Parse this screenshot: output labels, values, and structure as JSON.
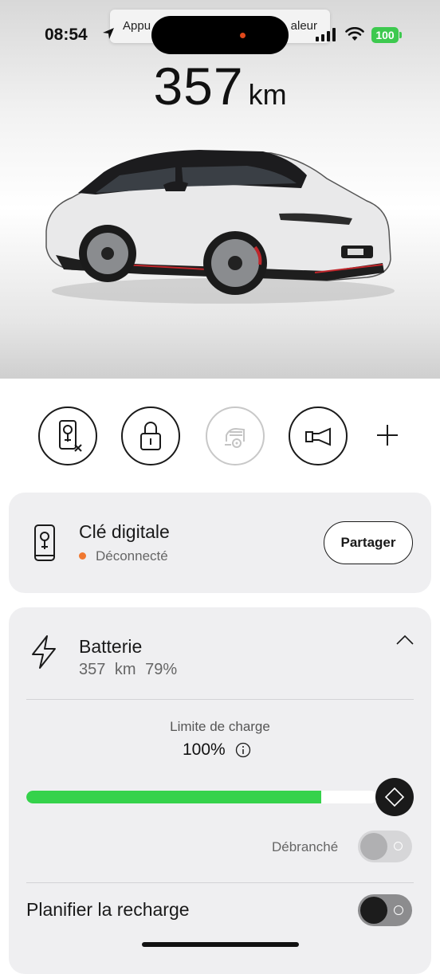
{
  "status_bar": {
    "time": "08:54",
    "battery": "100"
  },
  "notification": {
    "text_left": "Appu",
    "text_right": "aleur"
  },
  "vehicle": {
    "range_value": "357",
    "range_unit": "km"
  },
  "actions": [
    {
      "name": "digital-key-remove",
      "icon": "key-remove-icon",
      "enabled": true
    },
    {
      "name": "lock",
      "icon": "lock-icon",
      "enabled": true
    },
    {
      "name": "car-alarm",
      "icon": "car-alarm-icon",
      "enabled": false
    },
    {
      "name": "horn",
      "icon": "horn-icon",
      "enabled": true
    },
    {
      "name": "add",
      "icon": "plus-icon",
      "enabled": true
    }
  ],
  "digital_key": {
    "title": "Clé digitale",
    "status": "Déconnecté",
    "status_color": "#f07830",
    "share_label": "Partager"
  },
  "battery": {
    "title": "Batterie",
    "range": "357 km",
    "percent": "79%",
    "charge_limit_label": "Limite de charge",
    "charge_limit_value": "100%",
    "charge_level_fraction": 0.84,
    "accent_color": "#35d24b",
    "unplugged_label": "Débranché",
    "schedule_label": "Planifier la recharge"
  }
}
